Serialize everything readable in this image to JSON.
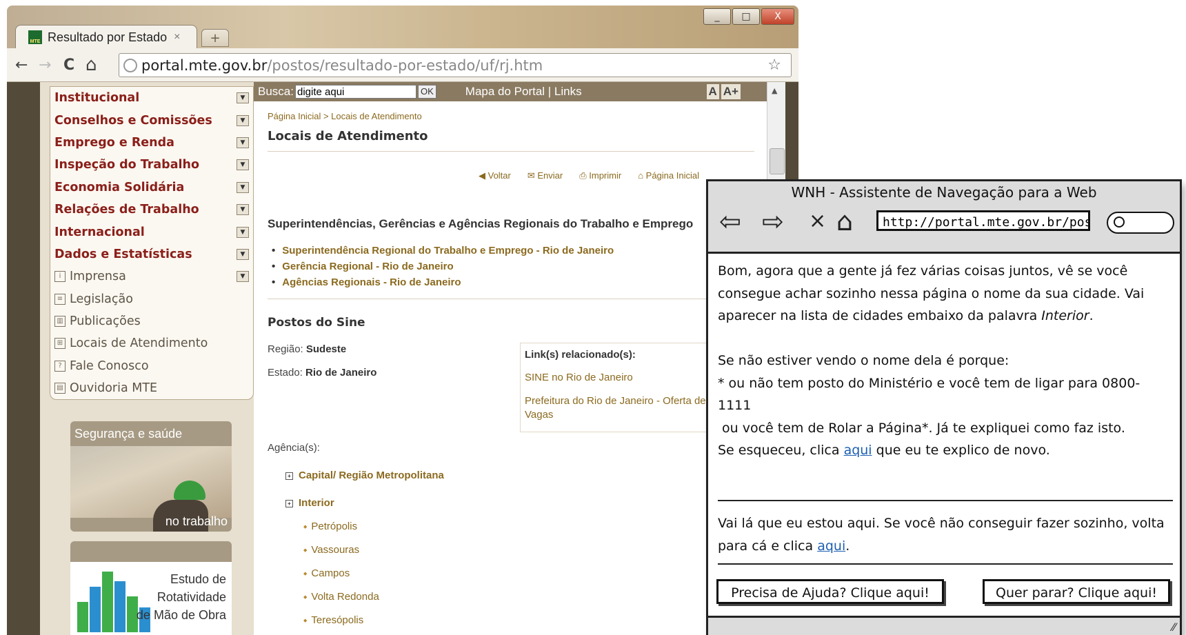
{
  "browser": {
    "tab_title": "Resultado por Estado",
    "tab_close": "×",
    "new_tab": "+",
    "url_host": "portal.mte.gov.br",
    "url_path": "/postos/resultado-por-estado/uf/rj.htm",
    "back": "←",
    "forward": "→",
    "reload": "C",
    "home": "⌂",
    "star": "☆",
    "wrench": "🔧",
    "win_min": "_",
    "win_max": "□",
    "win_close": "X",
    "favicon_text": "MTE"
  },
  "sidebar": {
    "items": [
      {
        "label": "Institucional",
        "dropdown": "▼"
      },
      {
        "label": "Conselhos e Comissões",
        "dropdown": "▼"
      },
      {
        "label": "Emprego e Renda",
        "dropdown": "▼"
      },
      {
        "label": "Inspeção do Trabalho",
        "dropdown": "▼"
      },
      {
        "label": "Economia Solidária",
        "dropdown": "▼"
      },
      {
        "label": "Relações de Trabalho",
        "dropdown": "▼"
      },
      {
        "label": "Internacional",
        "dropdown": "▼"
      },
      {
        "label": "Dados e Estatísticas",
        "dropdown": "▼"
      },
      {
        "label": "Imprensa",
        "icon": "i",
        "dropdown": "▼"
      },
      {
        "label": "Legislação",
        "icon": "≡"
      },
      {
        "label": "Publicações",
        "icon": "▥"
      },
      {
        "label": "Locais de Atendimento",
        "icon": "⊞"
      },
      {
        "label": "Fale Conosco",
        "icon": "?"
      },
      {
        "label": "Ouvidoria MTE",
        "icon": "▤"
      }
    ],
    "promo1_title": "Segurança e saúde",
    "promo1_caption": "no trabalho",
    "promo2_line1": "Estudo de",
    "promo2_line2": "Rotatividade",
    "promo2_line3": "de Mão de Obra"
  },
  "topbar": {
    "busca_label": "Busca:",
    "search_value": "digite aqui",
    "ok": "OK",
    "links": "Mapa do Portal | Links",
    "font_small": "A",
    "font_large": "A+"
  },
  "content": {
    "breadcrumb": "Página Inicial > Locais de Atendimento",
    "title": "Locais de Atendimento",
    "actions": {
      "voltar": "Voltar",
      "enviar": "Enviar",
      "imprimir": "Imprimir",
      "pagina_inicial": "Página Inicial"
    },
    "section_title": "Superintendências, Gerências e Agências Regionais do Trabalho e Emprego",
    "links": [
      "Superintendência Regional do Trabalho e Emprego - Rio de Janeiro",
      "Gerência Regional - Rio de Janeiro",
      "Agências Regionais - Rio de Janeiro"
    ],
    "postos_title": "Postos do Sine",
    "regiao_label": "Região:",
    "regiao_value": "Sudeste",
    "estado_label": "Estado:",
    "estado_value": "Rio de Janeiro",
    "related_title": "Link(s) relacionado(s):",
    "related_links": [
      "SINE no Rio de Janeiro",
      "Prefeitura do Rio de Janeiro - Oferta de Vagas"
    ],
    "agencias_label": "Agência(s):",
    "groups": [
      "Capital/ Região Metropolitana",
      "Interior"
    ],
    "cities": [
      "Petrópolis",
      "Vassouras",
      "Campos",
      "Volta Redonda",
      "Teresópolis"
    ]
  },
  "assistant": {
    "title": "WNH - Assistente de Navegação para a Web",
    "url": "http://portal.mte.gov.br/postos",
    "msg1_a": "Bom, agora que a gente já fez várias coisas juntos, vê se você consegue achar sozinho nessa página o nome da sua cidade. Vai aparecer na lista de cidades embaixo da palavra ",
    "msg1_em": "Interior",
    "msg1_b": ".",
    "msg2_line1": "Se não estiver vendo o nome dela é porque:",
    "msg2_line2": "* ou não tem posto do Ministério e você tem de ligar para 0800-1111",
    "msg2_line3": " ou você tem de Rolar a Página*. Já te expliquei como faz isto.",
    "msg2_line4a": "Se esqueceu, clica ",
    "link_text": "aqui",
    "msg2_line4b": " que eu te explico de novo.",
    "msg3_a": "Vai lá que eu estou aqui. Se você não conseguir fazer sozinho, volta para cá e clica ",
    "msg3_b": ".",
    "help_button": "Precisa de Ajuda? Clique aqui!",
    "stop_button": "Quer parar? Clique aqui!"
  }
}
